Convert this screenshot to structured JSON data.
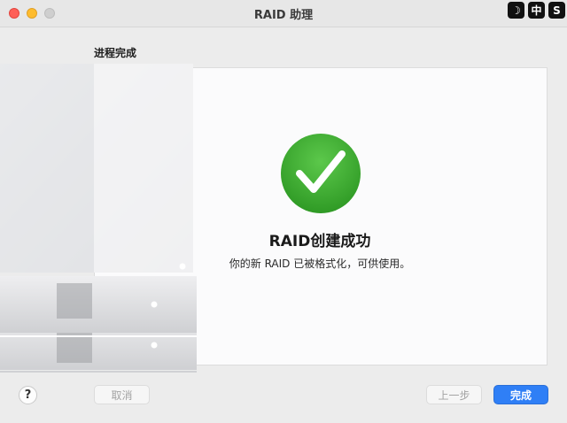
{
  "window": {
    "title": "RAID 助理"
  },
  "ime": {
    "moon": "☽",
    "zh": "中",
    "s": "S"
  },
  "step": {
    "title": "进程完成"
  },
  "result": {
    "title": "RAID创建成功",
    "description": "你的新 RAID 已被格式化，可供使用。"
  },
  "buttons": {
    "help": "?",
    "cancel": "取消",
    "back": "上一步",
    "done": "完成"
  },
  "colors": {
    "accent": "#2f7ff6",
    "success": "#3fae2a"
  }
}
